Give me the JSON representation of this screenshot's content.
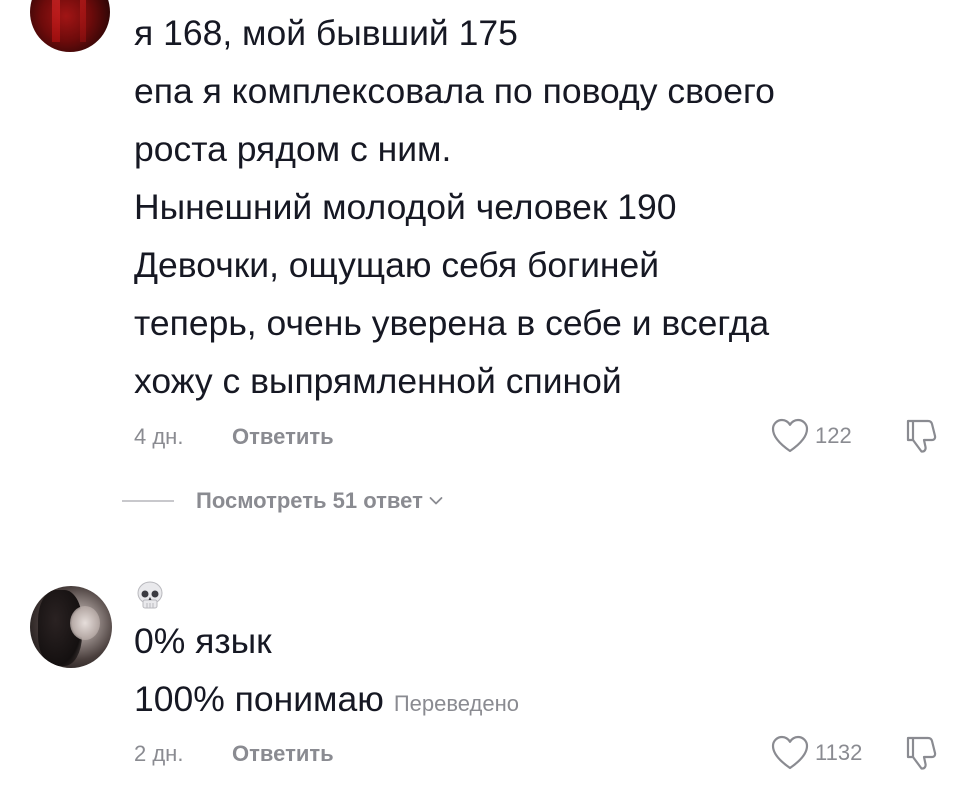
{
  "comments": [
    {
      "lines": [
        "я 168, мой бывший 175",
        "епа я комплексовала по поводу своего",
        "роста рядом с ним.",
        "Нынешний молодой человек 190",
        "Девочки, ощущаю себя богиней",
        "теперь, очень уверена в себе и всегда",
        "хожу с выпрямленной спиной"
      ],
      "time": "4 дн.",
      "reply_label": "Ответить",
      "likes": "122",
      "view_replies_label": "Посмотреть 51 ответ"
    },
    {
      "emoji": "💀",
      "lines": [
        "0% язык",
        "100% понимаю"
      ],
      "translated_label": "Переведено",
      "time": "2 дн.",
      "reply_label": "Ответить",
      "likes": "1132"
    }
  ],
  "colors": {
    "text": "#161823",
    "muted": "#8a8b91",
    "divider": "#c8c8cc"
  },
  "icons": {
    "like": "heart-outline-icon",
    "dislike": "thumbs-down-icon",
    "expand": "chevron-down-icon",
    "emoji": "skull-icon"
  }
}
